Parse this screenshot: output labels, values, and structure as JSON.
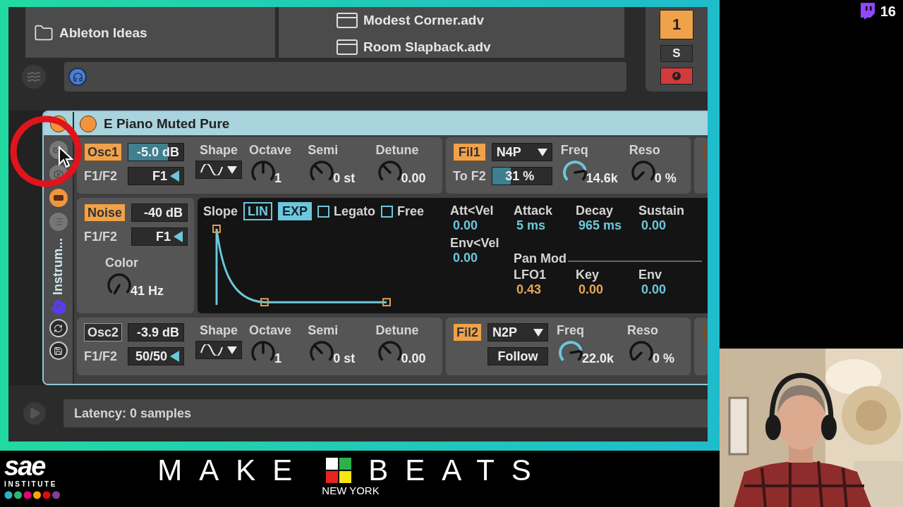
{
  "stream": {
    "viewer_count": "16"
  },
  "browser": {
    "folders": [
      "Ableton Ideas"
    ],
    "files": [
      "Modest Corner.adv",
      "Room Slapback.adv"
    ]
  },
  "track": {
    "number": "1",
    "solo": "S",
    "armed": true
  },
  "rack": {
    "label": "Instrum...",
    "on": true
  },
  "device": {
    "title": "E Piano Muted Pure",
    "on": true,
    "osc_rows": [
      {
        "toggle": {
          "label": "Osc1",
          "on": true
        },
        "volume": {
          "text": "-5.0 dB",
          "level": 0.72
        },
        "route_label": "F1/F2",
        "route": {
          "text": "F1",
          "kind": "arrow"
        },
        "shape_label": "Shape",
        "knobs": [
          {
            "label": "Octave",
            "value": "1"
          },
          {
            "label": "Semi",
            "value": "0 st"
          },
          {
            "label": "Detune",
            "value": "0.00"
          }
        ]
      },
      {
        "toggle": {
          "label": "Osc2",
          "on": false
        },
        "volume": {
          "text": "-3.9 dB"
        },
        "route_label": "F1/F2",
        "route": {
          "text": "50/50",
          "kind": "arrow"
        },
        "shape_label": "Shape",
        "knobs": [
          {
            "label": "Octave",
            "value": "1"
          },
          {
            "label": "Semi",
            "value": "0 st"
          },
          {
            "label": "Detune",
            "value": "0.00"
          }
        ]
      }
    ],
    "noise": {
      "toggle": {
        "label": "Noise",
        "on": true
      },
      "volume": {
        "text": "-40 dB"
      },
      "route_label": "F1/F2",
      "route": {
        "text": "F1",
        "kind": "arrow"
      },
      "color_knob": {
        "label": "Color",
        "value": "41 Hz"
      }
    },
    "filters": [
      {
        "toggle": {
          "label": "Fil1",
          "on": true
        },
        "type": "N4P",
        "sub": {
          "kind": "slider",
          "label": "To F2",
          "text": "31 %",
          "level": 0.31
        },
        "knobs": [
          {
            "label": "Freq",
            "value": "14.6k"
          },
          {
            "label": "Reso",
            "value": "0 %"
          }
        ]
      },
      {
        "toggle": {
          "label": "Fil2",
          "on": true
        },
        "type": "N2P",
        "sub": {
          "kind": "button",
          "text": "Follow"
        },
        "knobs": [
          {
            "label": "Freq",
            "value": "22.0k"
          },
          {
            "label": "Reso",
            "value": "0 %"
          }
        ]
      }
    ],
    "envelope": {
      "slope_label": "Slope",
      "slopes": [
        {
          "label": "LIN",
          "selected": false
        },
        {
          "label": "EXP",
          "selected": true
        }
      ],
      "options": [
        {
          "label": "Legato",
          "checked": false
        },
        {
          "label": "Free",
          "checked": false
        }
      ],
      "params": [
        {
          "label": "Att<Vel",
          "value": "0.00"
        },
        {
          "label": "Attack",
          "value": "5 ms"
        },
        {
          "label": "Decay",
          "value": "965 ms"
        },
        {
          "label": "Sustain",
          "value": "0.00"
        },
        {
          "label": "Env<Vel",
          "value": "0.00"
        }
      ],
      "pan_mod": {
        "title": "Pan Mod",
        "params": [
          {
            "label": "LFO1",
            "value": "0.43",
            "color": "#eaa655"
          },
          {
            "label": "Key",
            "value": "0.00",
            "color": "#eaa655"
          },
          {
            "label": "Env",
            "value": "0.00",
            "color": "#6cc7dc"
          }
        ]
      }
    }
  },
  "status": {
    "latency": "Latency: 0 samples"
  },
  "banner": {
    "school": "sae",
    "school_sub": "INSTITUTE",
    "brand_left": "MAKE",
    "brand_right": "BEATS",
    "city": "NEW YORK"
  }
}
